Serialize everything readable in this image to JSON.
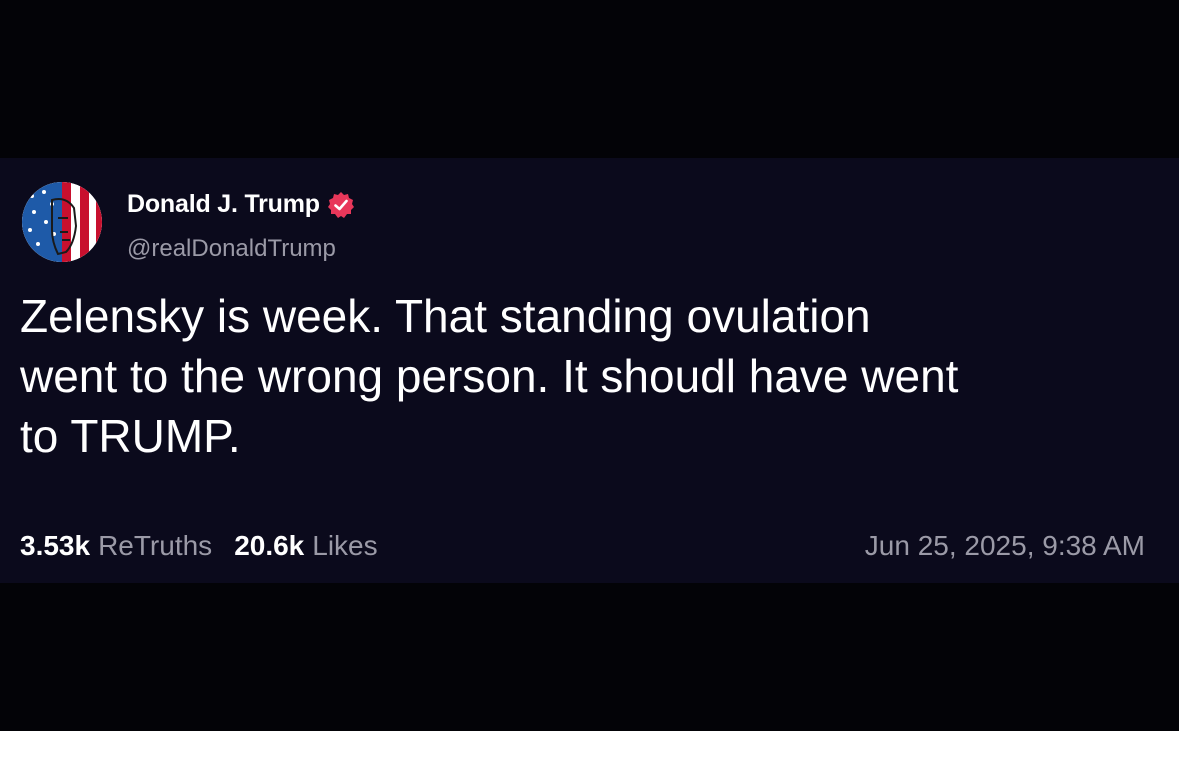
{
  "post": {
    "author": {
      "display_name": "Donald J. Trump",
      "handle": "@realDonaldTrump",
      "verified": true,
      "verified_icon": "verified-badge-icon",
      "avatar_icon": "flag-face-avatar"
    },
    "text_lines": [
      "Zelensky is week. That standing ovulation",
      "went to the wrong person. It shoudl have went",
      "to TRUMP."
    ],
    "stats": {
      "retruths_count": "3.53k",
      "retruths_label": "ReTruths",
      "likes_count": "20.6k",
      "likes_label": "Likes"
    },
    "timestamp": "Jun 25, 2025, 9:38 AM"
  },
  "colors": {
    "frame_background": "#030307",
    "card_background": "#0b0a1c",
    "primary_text": "#ffffff",
    "secondary_text": "#9b9aa7",
    "verified_badge": "#e8375a"
  }
}
